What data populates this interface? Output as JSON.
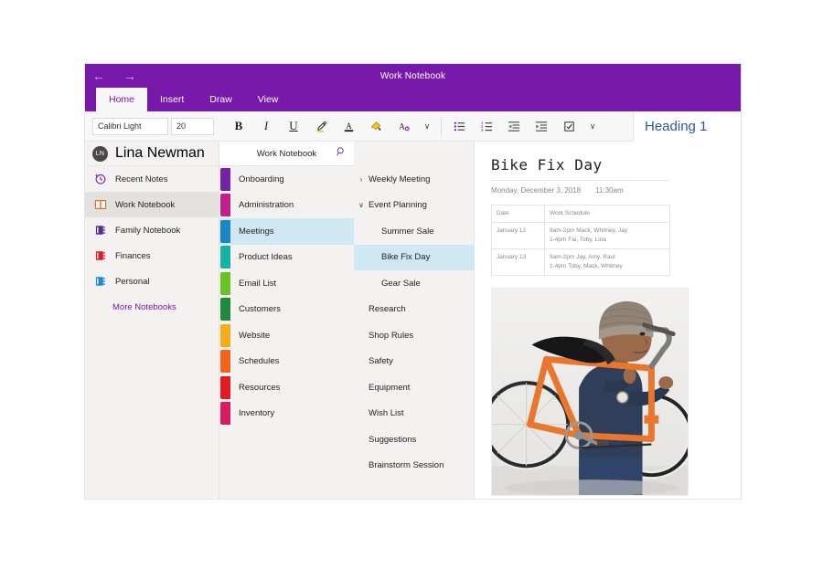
{
  "window": {
    "title": "Work Notebook",
    "nav_back": "←",
    "nav_forward": "→"
  },
  "ribbon_tabs": [
    {
      "label": "Home",
      "active": true
    },
    {
      "label": "Insert",
      "active": false
    },
    {
      "label": "Draw",
      "active": false
    },
    {
      "label": "View",
      "active": false
    }
  ],
  "ribbon": {
    "font_name": "Calibri Light",
    "font_size": "20",
    "bold_label": "B",
    "italic_label": "I",
    "underline_label": "U",
    "highlighter_name": "highlighter-icon",
    "font_color_label": "A",
    "format_painter_name": "format-painter-icon",
    "clear_formatting_label": "A",
    "text_overflow_caret": "∨",
    "bullets_name": "bulleted-list-icon",
    "numbering_name": "numbered-list-icon",
    "decrease_indent_name": "decrease-indent-icon",
    "increase_indent_name": "increase-indent-icon",
    "todo_tag_name": "checkbox-tag-icon",
    "list_overflow_caret": "∨",
    "style_name": "Heading 1"
  },
  "account": {
    "initials": "LN",
    "name": "Lina Newman"
  },
  "notebooks": [
    {
      "label": "Recent Notes",
      "icon": "recent-clock-icon",
      "color": "#7719aa",
      "selected": false
    },
    {
      "label": "Work Notebook",
      "icon": "open-notebook-icon",
      "color": "#e8661d",
      "selected": true
    },
    {
      "label": "Family Notebook",
      "icon": "notebook-icon",
      "color": "#5b2d90",
      "selected": false
    },
    {
      "label": "Finances",
      "icon": "notebook-icon",
      "color": "#e01b24",
      "selected": false
    },
    {
      "label": "Personal",
      "icon": "notebook-icon",
      "color": "#1b8bd0",
      "selected": false
    }
  ],
  "more_notebooks_label": "More Notebooks",
  "section_search": {
    "title": "Work Notebook",
    "icon": "search-icon"
  },
  "sections": [
    {
      "label": "Onboarding",
      "color": "#7322a3",
      "selected": false
    },
    {
      "label": "Administration",
      "color": "#c1208b",
      "selected": false
    },
    {
      "label": "Meetings",
      "color": "#1b86c4",
      "selected": true
    },
    {
      "label": "Product Ideas",
      "color": "#14b3a6",
      "selected": false
    },
    {
      "label": "Email List",
      "color": "#6cc224",
      "selected": false
    },
    {
      "label": "Customers",
      "color": "#1d8a3c",
      "selected": false
    },
    {
      "label": "Website",
      "color": "#f6ab1c",
      "selected": false
    },
    {
      "label": "Schedules",
      "color": "#f2641e",
      "selected": false
    },
    {
      "label": "Resources",
      "color": "#e01b24",
      "selected": false
    },
    {
      "label": "Inventory",
      "color": "#d81b60",
      "selected": false
    }
  ],
  "pages": [
    {
      "label": "Weekly Meeting",
      "level": 0,
      "caret": "›",
      "selected": false
    },
    {
      "label": "Event Planning",
      "level": 0,
      "caret": "∨",
      "selected": false
    },
    {
      "label": "Summer Sale",
      "level": 1,
      "caret": "",
      "selected": false
    },
    {
      "label": "Bike Fix Day",
      "level": 1,
      "caret": "",
      "selected": true
    },
    {
      "label": "Gear Sale",
      "level": 1,
      "caret": "",
      "selected": false
    },
    {
      "label": "Research",
      "level": 0,
      "caret": "",
      "selected": false
    },
    {
      "label": "Shop Rules",
      "level": 0,
      "caret": "",
      "selected": false
    },
    {
      "label": "Safety",
      "level": 0,
      "caret": "",
      "selected": false
    },
    {
      "label": "Equipment",
      "level": 0,
      "caret": "",
      "selected": false
    },
    {
      "label": "Wish List",
      "level": 0,
      "caret": "",
      "selected": false
    },
    {
      "label": "Suggestions",
      "level": 0,
      "caret": "",
      "selected": false
    },
    {
      "label": "Brainstorm Session",
      "level": 0,
      "caret": "",
      "selected": false
    }
  ],
  "note": {
    "title": "Bike Fix Day",
    "date": "Monday, December 3, 2018",
    "time": "11:30am",
    "table": {
      "headers": [
        "Date",
        "Work Schedule"
      ],
      "rows": [
        {
          "date": "January 12",
          "shift_am": "9am-2pm Mack, Whitney, Jay",
          "shift_pm": "1-4pm Fai, Toby, Lina"
        },
        {
          "date": "January 13",
          "shift_am": "9am-2pm Jay, Amy, Raul",
          "shift_pm": "1-4pm Toby, Mack, Whitney"
        }
      ]
    },
    "photo_name": "man-carrying-orange-bicycle-photo"
  },
  "colors": {
    "brand_purple": "#7719aa",
    "selection_blue": "#cfe8f3",
    "nav_bg": "#f3f2f1",
    "style_blue": "#2b579a"
  }
}
